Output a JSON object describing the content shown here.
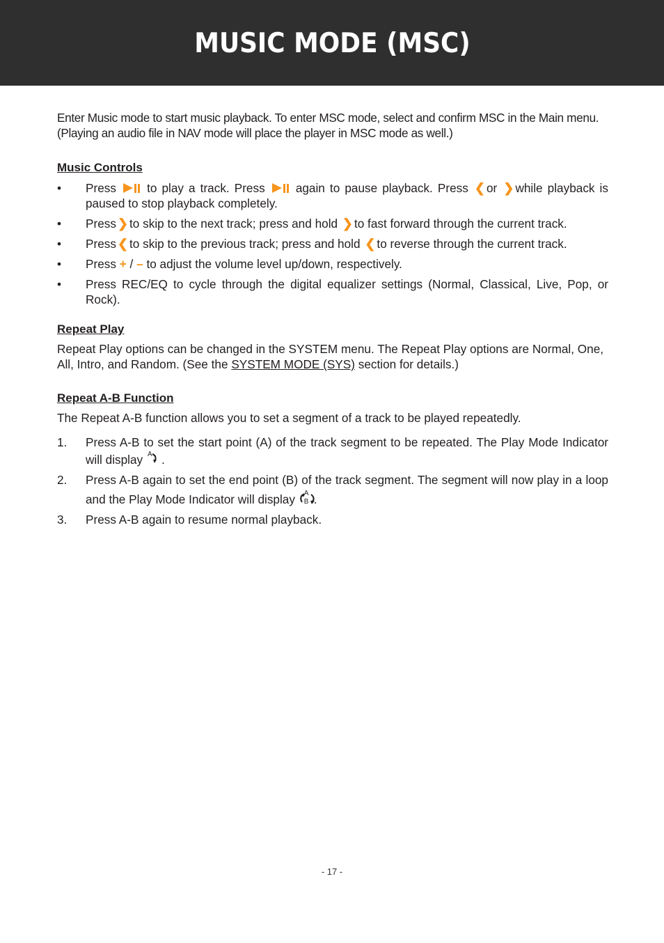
{
  "header": {
    "title": "MUSIC MODE (MSC)"
  },
  "intro": "Enter Music mode to start music playback. To enter MSC mode, select and confirm MSC in the Main menu. (Playing an audio file in NAV mode will place the player in MSC mode as well.)",
  "music_controls": {
    "title": "Music Controls",
    "bullet": "•",
    "items": [
      {
        "parts": [
          "Press",
          "play-pause-icon",
          "to play a track. Press",
          "play-pause-icon",
          "again to pause playback. Press",
          "previous-icon",
          "or",
          "next-icon",
          "while playback is paused to stop playback completely."
        ]
      },
      {
        "parts": [
          "Press",
          "next-icon",
          "to skip to the next track; press and hold",
          "next-icon",
          "to fast forward through the current track."
        ]
      },
      {
        "parts": [
          "Press",
          "previous-icon",
          "to skip to the previous track; press and hold",
          "previous-icon",
          "to reverse through the current track."
        ]
      },
      {
        "parts": [
          "Press",
          "plus-icon",
          "/",
          "minus-icon",
          "to adjust the volume level up/down, respectively."
        ]
      },
      {
        "parts": [
          "Press REC/EQ to cycle through the digital equalizer settings (Normal, Classical, Live, Pop, or Rock)."
        ]
      }
    ],
    "texts": {
      "i0a": "Press",
      "i0b": "to play a track. Press",
      "i0c": "again to pause playback. Press",
      "i0d": "or",
      "i0e": "while playback is paused to stop playback completely.",
      "i1a": "Press",
      "i1b": "to skip to the next track; press and hold",
      "i1c": "to fast forward through the current track.",
      "i2a": "Press",
      "i2b": "to skip to the previous track; press and hold",
      "i2c": "to reverse through the current track.",
      "i3a": "Press",
      "i3b": "/",
      "i3c": "to adjust the volume level up/down, respectively.",
      "i4a": "Press REC/EQ to cycle through the digital equalizer settings (Normal, Classical, Live, Pop, or Rock)."
    },
    "glyphs": {
      "next": "❯",
      "previous": "❮",
      "plus": "+",
      "minus": "–"
    }
  },
  "repeat_play": {
    "title": "Repeat Play",
    "text_before_link": "Repeat Play options can be changed in the SYSTEM menu. The Repeat Play options are Normal, One, All, Intro, and Random. (See the",
    "link": "SYSTEM MODE (SYS)",
    "text_after_link": "section for details.)"
  },
  "repeat_ab": {
    "title": "Repeat A-B Function",
    "intro": "The Repeat A-B function allows you to set a segment of a track to be played repeatedly.",
    "steps": [
      {
        "num": "1.",
        "text": "Press A-B to set the start point (A) of the track segment to be repeated. The Play Mode Indicator will display",
        "icon": "repeat-a-icon",
        "end": "."
      },
      {
        "num": "2.",
        "text": "Press A-B again to set the end point (B) of the track segment. The segment will now play in a loop and the Play Mode Indicator will display",
        "icon": "repeat-ab-icon",
        "end": "."
      },
      {
        "num": "3.",
        "text": "Press A-B again to resume normal playback."
      }
    ],
    "icon_labels": {
      "a": "A",
      "b": "B"
    }
  },
  "footer": {
    "page_number": "- 17 -"
  },
  "colors": {
    "accent": "#f7941d",
    "header_bg": "#2f2f2f",
    "text": "#231f20"
  }
}
